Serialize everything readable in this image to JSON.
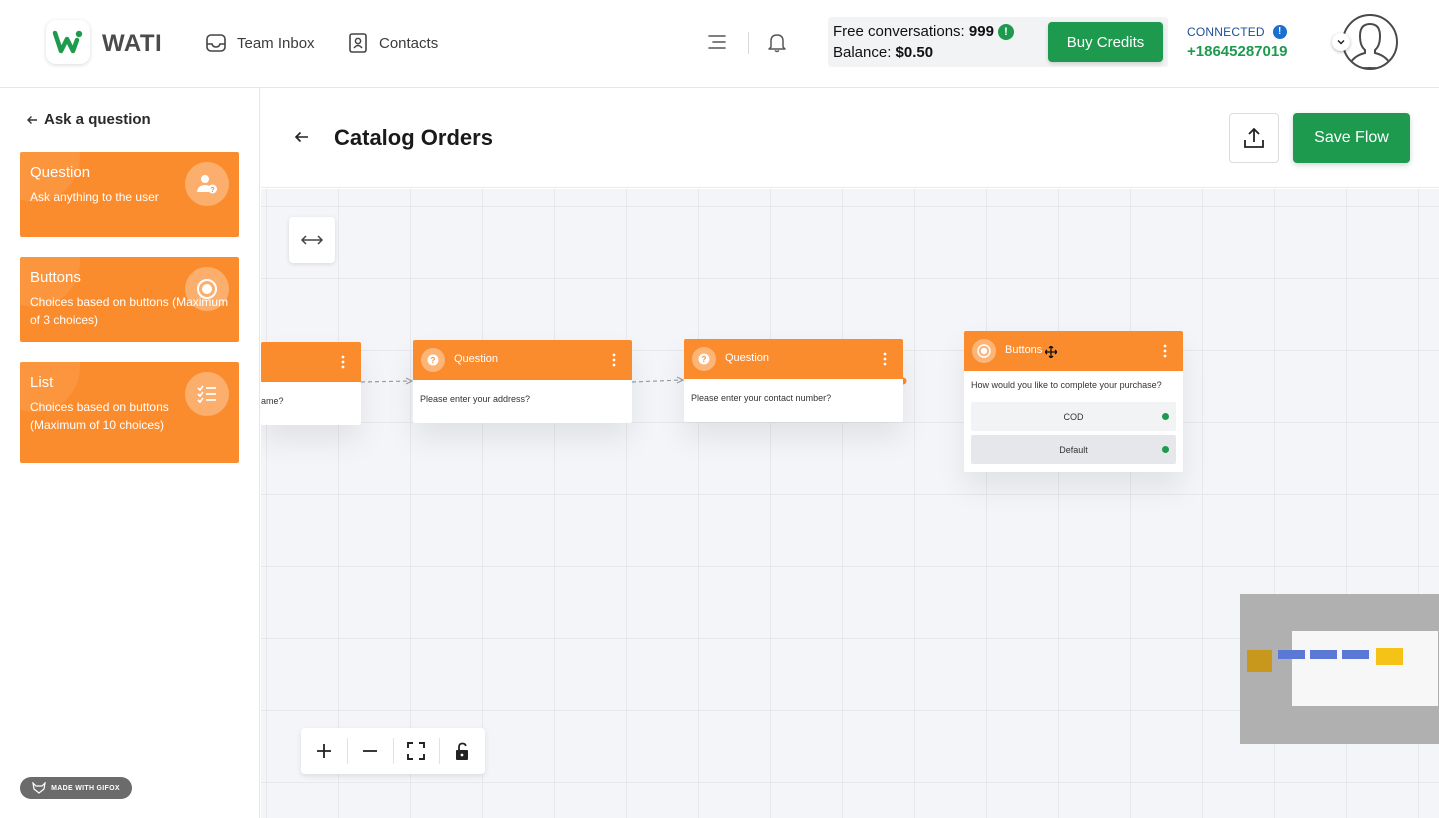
{
  "header": {
    "brand": "WATI",
    "nav": [
      {
        "label": "Team Inbox",
        "icon": "inbox-icon"
      },
      {
        "label": "Contacts",
        "icon": "contacts-icon"
      }
    ],
    "credits": {
      "free_label": "Free conversations: ",
      "free_value": "999",
      "balance_label": "Balance: ",
      "balance_value": "$0.50",
      "buy_label": "Buy Credits"
    },
    "connection": {
      "status": "CONNECTED",
      "phone": "+18645287019"
    }
  },
  "sidebar": {
    "title": "Ask a question",
    "cards": [
      {
        "title": "Question",
        "desc": "Ask anything to the user",
        "icon": "user-question-icon"
      },
      {
        "title": "Buttons",
        "desc": "Choices based on buttons (Maximum of 3 choices)",
        "icon": "radio-button-icon"
      },
      {
        "title": "List",
        "desc": "Choices based on buttons (Maximum of 10 choices)",
        "icon": "checklist-icon"
      }
    ],
    "watermark": "MADE WITH GIFOX"
  },
  "flow": {
    "title": "Catalog Orders",
    "save_label": "Save Flow"
  },
  "nodes": [
    {
      "title": "",
      "body": "ame?"
    },
    {
      "title": "Question",
      "body": "Please enter your address?"
    },
    {
      "title": "Question",
      "body": "Please enter your contact number?"
    },
    {
      "title": "Buttons",
      "body": "How would you like to complete your purchase?",
      "options": [
        "COD",
        "Default"
      ]
    }
  ],
  "colors": {
    "accent_orange": "#fb8c2e",
    "brand_green": "#1d9a4e",
    "connected_blue": "#1a4f9c"
  }
}
